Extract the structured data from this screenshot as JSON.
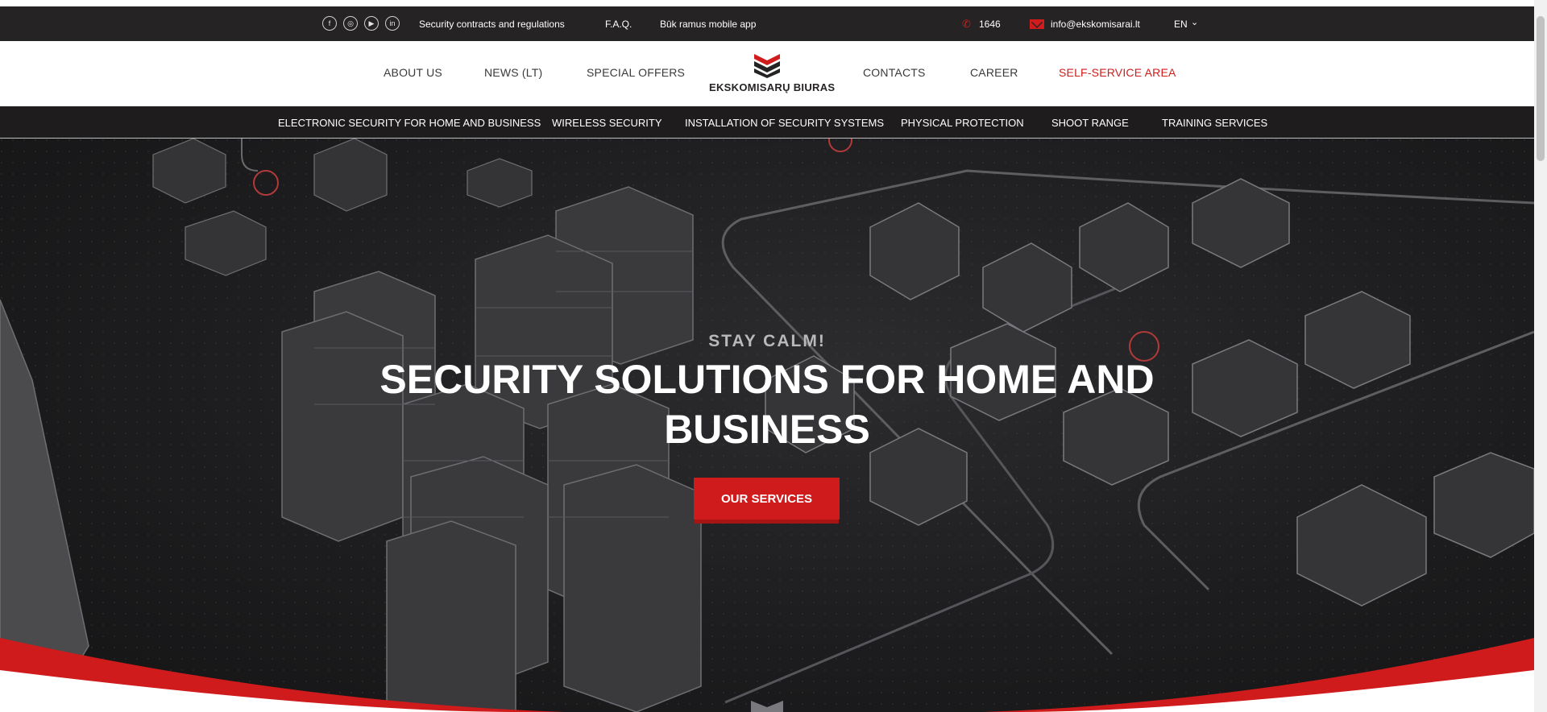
{
  "topbar": {
    "social": [
      {
        "name": "facebook-icon",
        "glyph": "f"
      },
      {
        "name": "instagram-icon",
        "glyph": "◎"
      },
      {
        "name": "youtube-icon",
        "glyph": "▶"
      },
      {
        "name": "linkedin-icon",
        "glyph": "in"
      }
    ],
    "links": [
      "Security contracts and regulations",
      "F.A.Q.",
      "Būk ramus mobile app"
    ],
    "phone": "1646",
    "email": "info@ekskomisarai.lt",
    "language": "EN"
  },
  "mainnav": {
    "items_left": [
      "ABOUT US",
      "NEWS (LT)",
      "SPECIAL OFFERS"
    ],
    "logo_text": "EKSKOMISARŲ BIURAS",
    "items_right": [
      "CONTACTS",
      "CAREER",
      "SELF-SERVICE AREA"
    ]
  },
  "subnav": {
    "items": [
      "ELECTRONIC SECURITY FOR HOME AND BUSINESS",
      "WIRELESS SECURITY",
      "INSTALLATION OF SECURITY SYSTEMS",
      "PHYSICAL PROTECTION",
      "SHOOT RANGE",
      "TRAINING SERVICES"
    ]
  },
  "hero": {
    "eyebrow": "STAY CALM!",
    "headline": "SECURITY SOLUTIONS FOR HOME AND BUSINESS",
    "cta_label": "OUR SERVICES"
  },
  "colors": {
    "accent": "#d01c1c",
    "dark": "#262324"
  }
}
